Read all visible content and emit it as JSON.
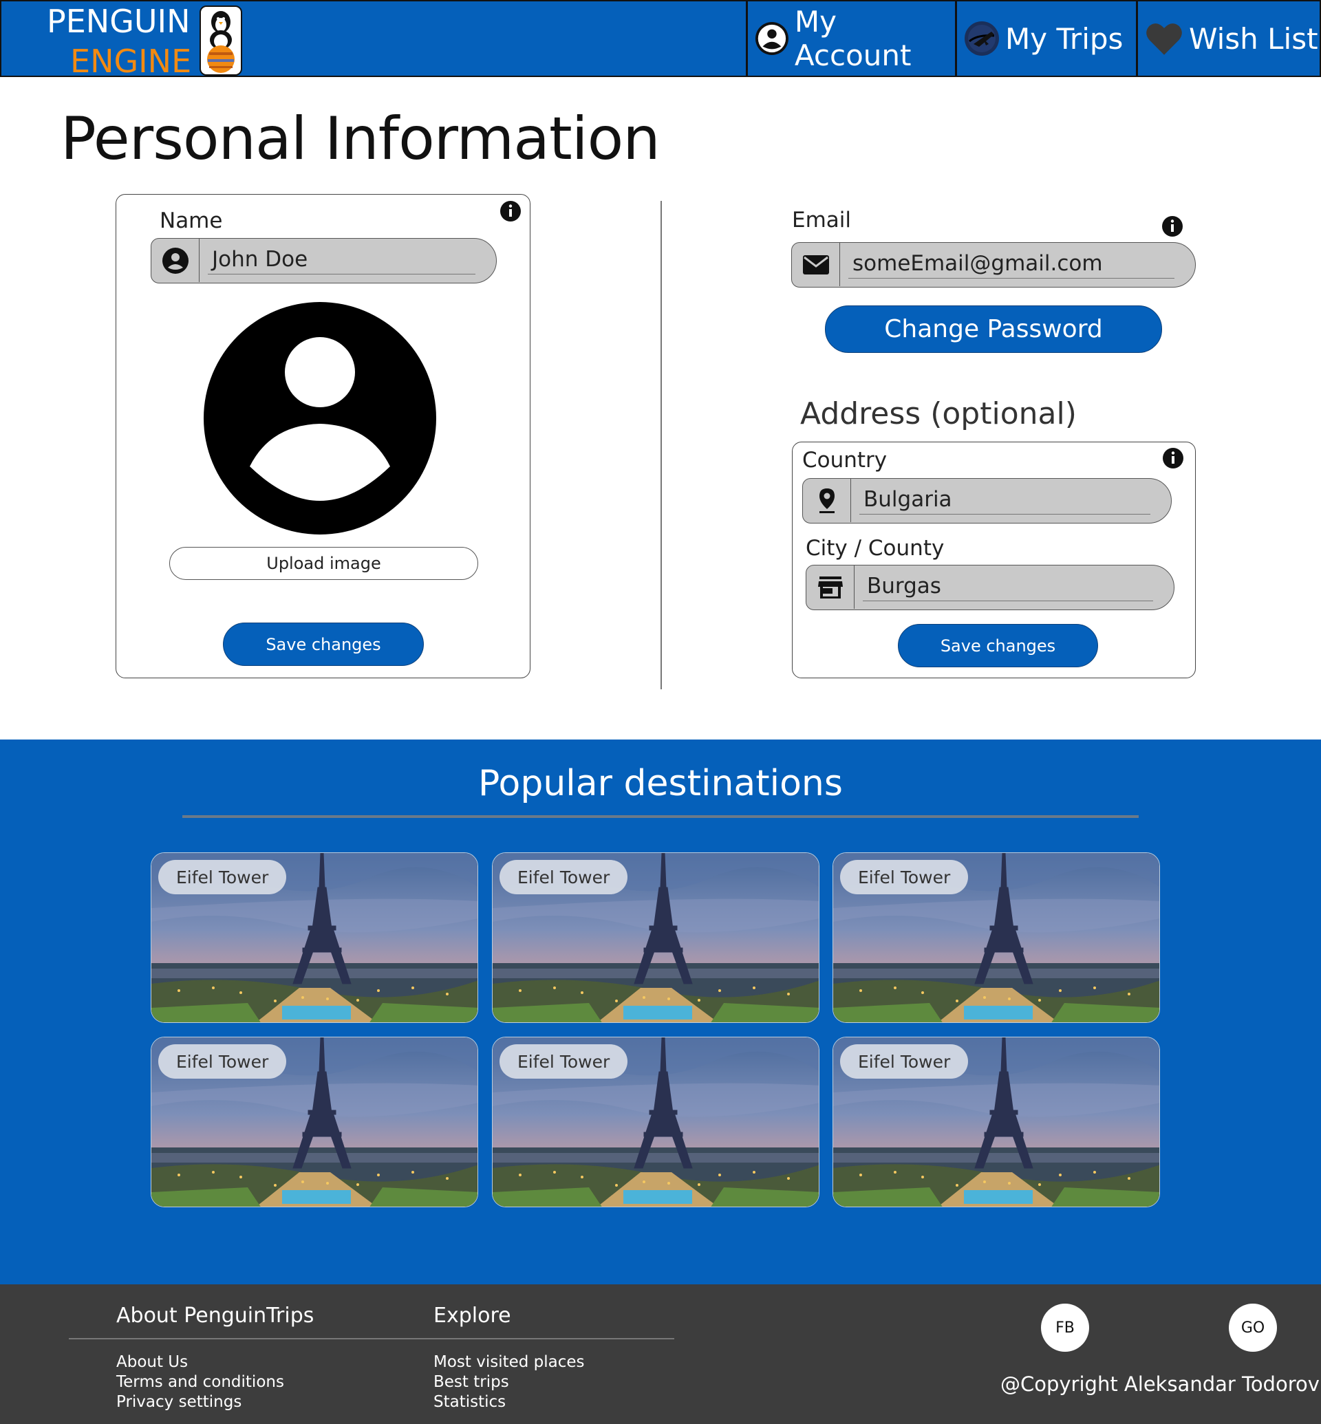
{
  "header": {
    "brand_line1": "PENGUIN",
    "brand_line2": "ENGINE",
    "nav": [
      {
        "label": "My Account",
        "icon": "account-circle-icon"
      },
      {
        "label": "My Trips",
        "icon": "trips-globe-icon"
      },
      {
        "label": "Wish List",
        "icon": "heart-icon"
      }
    ]
  },
  "main": {
    "title": "Personal Information",
    "profile_card": {
      "name_label": "Name",
      "name_value": "John Doe",
      "upload_label": "Upload image",
      "save_label": "Save changes"
    },
    "account_card": {
      "email_label": "Email",
      "email_value": "someEmail@gmail.com",
      "change_password_label": "Change Password"
    },
    "address_card": {
      "heading": "Address (optional)",
      "country_label": "Country",
      "country_value": "Bulgaria",
      "city_label": "City / County",
      "city_value": "Burgas",
      "save_label": "Save changes"
    }
  },
  "popular": {
    "title": "Popular destinations",
    "destinations": [
      {
        "name": "Eifel Tower"
      },
      {
        "name": "Eifel Tower"
      },
      {
        "name": "Eifel Tower"
      },
      {
        "name": "Eifel Tower"
      },
      {
        "name": "Eifel Tower"
      },
      {
        "name": "Eifel Tower"
      }
    ]
  },
  "footer": {
    "about_heading": "About PenguinTrips",
    "about_links": [
      "About Us",
      "Terms and conditions",
      "Privacy settings"
    ],
    "explore_heading": "Explore",
    "explore_links": [
      "Most visited places",
      "Best trips",
      "Statistics"
    ],
    "social": [
      "FB",
      "GO"
    ],
    "copyright": "@Copyright Aleksandar Todorov"
  },
  "colors": {
    "brand_blue": "#0560ba",
    "brand_orange": "#f28a12",
    "footer_bg": "#3d3d3d",
    "field_bg": "#c9c9c9"
  }
}
